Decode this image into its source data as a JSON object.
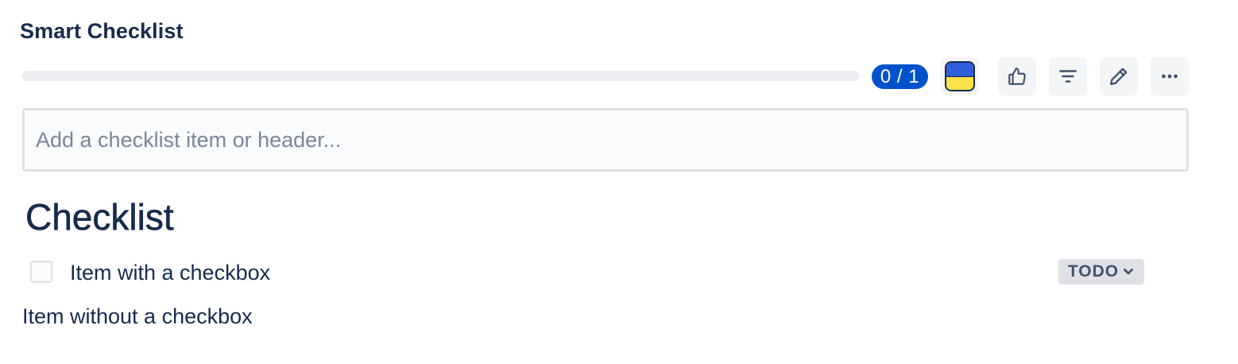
{
  "title": "Smart Checklist",
  "progress": {
    "done": 0,
    "total": 1,
    "fraction": 0,
    "label": "0 / 1"
  },
  "toolbar": {
    "buttons": [
      {
        "name": "flag-theme-button",
        "icon": "ukraine-flag-icon"
      },
      {
        "name": "like-button",
        "icon": "thumbs-up-icon"
      },
      {
        "name": "filter-button",
        "icon": "filter-icon"
      },
      {
        "name": "edit-button",
        "icon": "pencil-icon"
      },
      {
        "name": "more-button",
        "icon": "ellipsis-icon"
      }
    ]
  },
  "add_input": {
    "placeholder": "Add a checklist item or header...",
    "value": ""
  },
  "section": {
    "header": "Checklist"
  },
  "items": [
    {
      "text": "Item with a checkbox",
      "checkbox": true,
      "checked": false,
      "status": "TODO"
    },
    {
      "text": "Item without a checkbox",
      "checkbox": false
    }
  ],
  "colors": {
    "badge": "#0052cc",
    "flag_blue": "#2f5fdc",
    "flag_yellow": "#fde34a",
    "text": "#172b4d",
    "track": "#ebecf0"
  }
}
